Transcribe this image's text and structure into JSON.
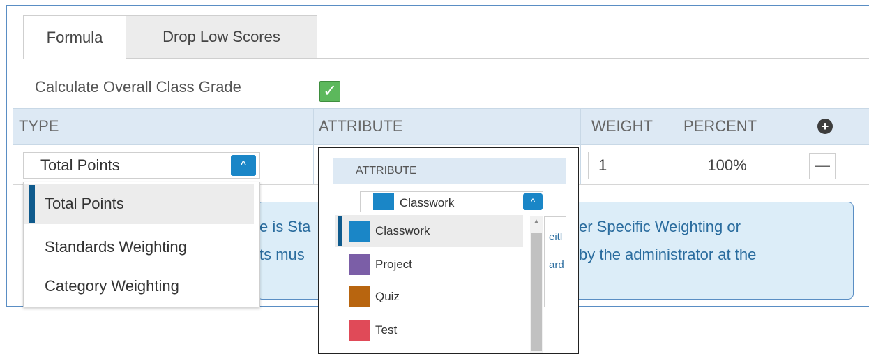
{
  "tabs": [
    {
      "label": "Formula",
      "active": true
    },
    {
      "label": "Drop Low Scores",
      "active": false
    }
  ],
  "calculate_overall": {
    "label": "Calculate Overall Class Grade",
    "checked": true,
    "check_glyph": "✓"
  },
  "table": {
    "headers": {
      "type": "TYPE",
      "attribute": "ATTRIBUTE",
      "weight": "WEIGHT",
      "percent": "PERCENT"
    },
    "add_icon": "plus-circle-icon",
    "row": {
      "type_value": "Total Points",
      "weight_value": "1",
      "percent_value": "100%",
      "remove_glyph": "—"
    }
  },
  "type_dropdown": {
    "chevron_glyph": "^",
    "options": [
      "Total Points",
      "Standards Weighting",
      "Category Weighting"
    ],
    "selected": "Total Points"
  },
  "info_banner": {
    "fragments": [
      "e is Sta",
      "ts mus",
      "er Specific Weighting or",
      "by the administrator at the"
    ]
  },
  "attribute_inset": {
    "header": "ATTRIBUTE",
    "selected_label": "Classwork",
    "chevron_glyph": "^",
    "scroll_up_glyph": "▲",
    "fragments": [
      "eitl",
      "ard"
    ],
    "options": [
      {
        "label": "Classwork",
        "color": "#1a86c7"
      },
      {
        "label": "Project",
        "color": "#7b5ea7"
      },
      {
        "label": "Quiz",
        "color": "#b8650f"
      },
      {
        "label": "Test",
        "color": "#e04a58"
      }
    ]
  },
  "colors": {
    "accent": "#1a86c7",
    "header_bg": "#dde9f4",
    "check_green": "#5cb85c",
    "info_text": "#2a6c9e"
  }
}
